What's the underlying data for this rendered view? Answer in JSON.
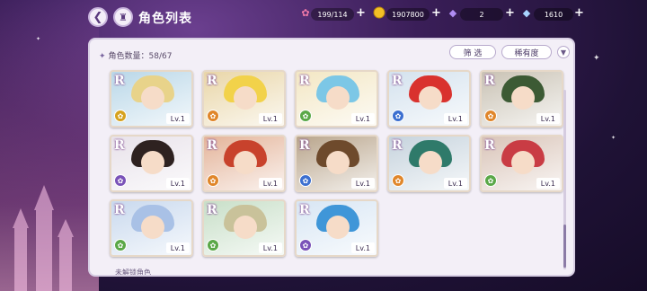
{
  "header": {
    "title": "角色列表",
    "back_icon": "back-arrow-icon",
    "home_icon": "castle-home-icon"
  },
  "resources": [
    {
      "name": "candy",
      "icon": "candy-icon",
      "value": "199/114",
      "color": "#f07aa8"
    },
    {
      "name": "gold",
      "icon": "coin-icon",
      "value": "1907800",
      "color": "#f2c026"
    },
    {
      "name": "crystal",
      "icon": "purple-diamond-icon",
      "value": "2",
      "color": "#9a7df0"
    },
    {
      "name": "gem",
      "icon": "blue-diamond-icon",
      "value": "1610",
      "color": "#8fc6ff"
    }
  ],
  "panel": {
    "count_label": "角色数量：58/67",
    "filter_label": "筛 选",
    "sort_label": "稀有度",
    "footer_hint": "未解锁角色"
  },
  "cards": [
    {
      "rank": "R",
      "level": "Lv.1",
      "element": "yellow",
      "elem_color": "#d6a21e",
      "hair": "#e8d38a",
      "bg": "#b9d7e8"
    },
    {
      "rank": "R",
      "level": "Lv.1",
      "element": "orange",
      "elem_color": "#e0862a",
      "hair": "#f2d24a",
      "bg": "#e9d6a8"
    },
    {
      "rank": "R",
      "level": "Lv.1",
      "element": "green",
      "elem_color": "#5aa848",
      "hair": "#7cc7e6",
      "bg": "#f3e7c4"
    },
    {
      "rank": "R",
      "level": "Lv.1",
      "element": "blue",
      "elem_color": "#3b6fd0",
      "hair": "#d9322e",
      "bg": "#d4e2ee"
    },
    {
      "rank": "R",
      "level": "Lv.1",
      "element": "orange",
      "elem_color": "#e0862a",
      "hair": "#3c5a34",
      "bg": "#c9c2b4"
    },
    {
      "rank": "R",
      "level": "Lv.1",
      "element": "purple",
      "elem_color": "#7a52b8",
      "hair": "#2e2220",
      "bg": "#e8e2ea"
    },
    {
      "rank": "R",
      "level": "Lv.1",
      "element": "orange",
      "elem_color": "#e0862a",
      "hair": "#c8422c",
      "bg": "#e4b49a"
    },
    {
      "rank": "R",
      "level": "Lv.1",
      "element": "blue",
      "elem_color": "#3b6fd0",
      "hair": "#6e4a2c",
      "bg": "#b9a58c"
    },
    {
      "rank": "R",
      "level": "Lv.1",
      "element": "orange",
      "elem_color": "#e0862a",
      "hair": "#2f7a6a",
      "bg": "#c6d3dd"
    },
    {
      "rank": "R",
      "level": "Lv.1",
      "element": "green",
      "elem_color": "#5aa848",
      "hair": "#c93c44",
      "bg": "#d9c4b8"
    },
    {
      "rank": "R",
      "level": "Lv.1",
      "element": "green",
      "elem_color": "#5aa848",
      "hair": "#a9c1e6",
      "bg": "#c9d9ee"
    },
    {
      "rank": "R",
      "level": "Lv.1",
      "element": "green",
      "elem_color": "#5aa848",
      "hair": "#c9c29a",
      "bg": "#c8dfc8"
    },
    {
      "rank": "R",
      "level": "Lv.1",
      "element": "purple",
      "elem_color": "#7a52b8",
      "hair": "#3f96d8",
      "bg": "#d8e6f4"
    }
  ]
}
